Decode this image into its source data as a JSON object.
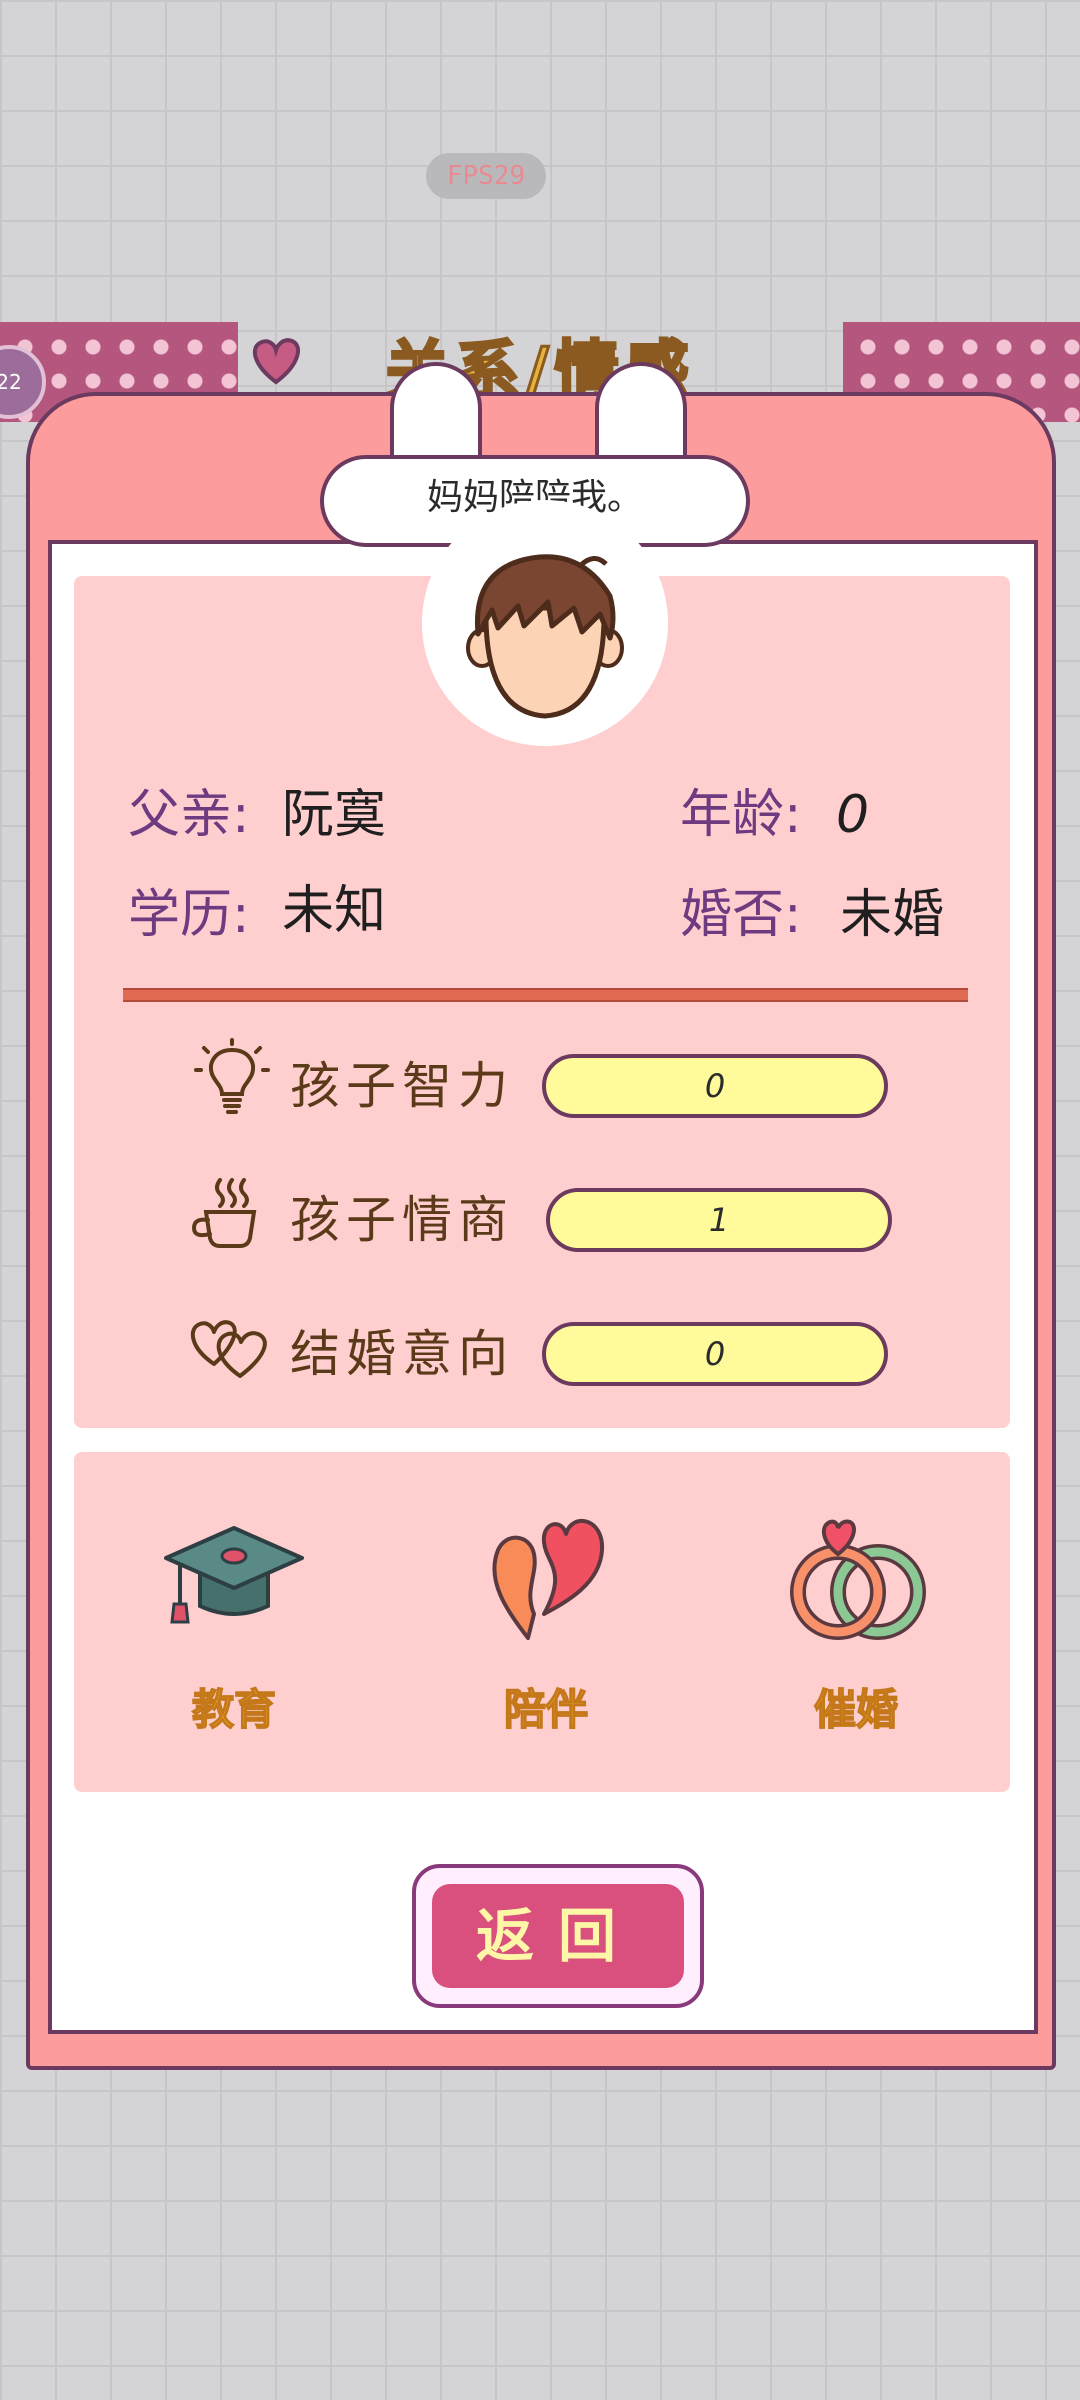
{
  "hud": {
    "fps": "FPS29"
  },
  "background": {
    "title": "关系/情感",
    "side_badge": "22"
  },
  "speech": "妈妈陪陪我。",
  "profile": {
    "father_label": "父亲:",
    "father_value": "阮寞",
    "age_label": "年龄:",
    "age_value": "0",
    "education_label": "学历:",
    "education_value": "未知",
    "marital_label": "婚否:",
    "marital_value": "未婚"
  },
  "stats": [
    {
      "label": "孩子智力",
      "value": "0",
      "icon": "lightbulb-icon"
    },
    {
      "label": "孩子情商",
      "value": "1",
      "icon": "coffee-cup-icon"
    },
    {
      "label": "结婚意向",
      "value": "0",
      "icon": "double-heart-icon"
    }
  ],
  "actions": [
    {
      "label": "教育",
      "icon": "graduation-cap-icon"
    },
    {
      "label": "陪伴",
      "icon": "broken-hearts-icon"
    },
    {
      "label": "催婚",
      "icon": "rings-icon"
    }
  ],
  "return_label": "返回",
  "colors": {
    "dialog_frame": "#fd9c9c",
    "panel": "#ffcfd0",
    "stat_bar": "#fffb9a",
    "action_text": "#f5b72c",
    "return_button": "#d94f7d"
  }
}
